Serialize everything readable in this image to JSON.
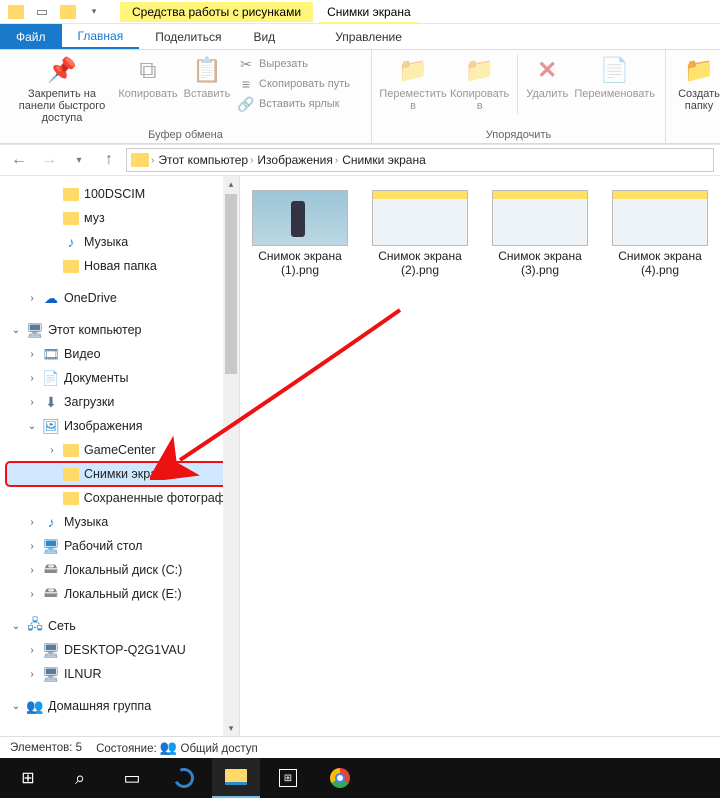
{
  "titlebar": {
    "context_tool_title": "Средства работы с рисунками",
    "window_title": "Снимки экрана"
  },
  "tabs": {
    "file": "Файл",
    "home": "Главная",
    "share": "Поделиться",
    "view": "Вид",
    "manage": "Управление"
  },
  "ribbon": {
    "pin": "Закрепить на панели быстрого доступа",
    "copy": "Копировать",
    "paste": "Вставить",
    "cut": "Вырезать",
    "copy_path": "Скопировать путь",
    "paste_shortcut": "Вставить ярлык",
    "group_clipboard": "Буфер обмена",
    "move_to": "Переместить в",
    "copy_to": "Копировать в",
    "delete": "Удалить",
    "rename": "Переименовать",
    "group_organize": "Упорядочить",
    "new_folder": "Создать папку"
  },
  "breadcrumbs": [
    "Этот компьютер",
    "Изображения",
    "Снимки экрана"
  ],
  "tree": {
    "dcim": "100DSCIM",
    "muz": "муз",
    "music": "Музыка",
    "newfolder": "Новая папка",
    "onedrive": "OneDrive",
    "thispc": "Этот компьютер",
    "video": "Видео",
    "documents": "Документы",
    "downloads": "Загрузки",
    "pictures": "Изображения",
    "gamecenter": "GameCenter",
    "screenshots": "Снимки экрана",
    "savedphotos": "Сохраненные фотографии",
    "music2": "Музыка",
    "desktop": "Рабочий стол",
    "diskc": "Локальный диск (C:)",
    "diske": "Локальный диск (E:)",
    "network": "Сеть",
    "pc1": "DESKTOP-Q2G1VAU",
    "pc2": "ILNUR",
    "homegroup": "Домашняя группа"
  },
  "files": [
    {
      "name": "Снимок экрана (1).png",
      "kind": "photo"
    },
    {
      "name": "Снимок экрана (2).png",
      "kind": "shot"
    },
    {
      "name": "Снимок экрана (3).png",
      "kind": "shot"
    },
    {
      "name": "Снимок экрана (4).png",
      "kind": "shot"
    }
  ],
  "status": {
    "elements": "Элементов: 5",
    "state_label": "Состояние:",
    "state_value": "Общий доступ"
  }
}
